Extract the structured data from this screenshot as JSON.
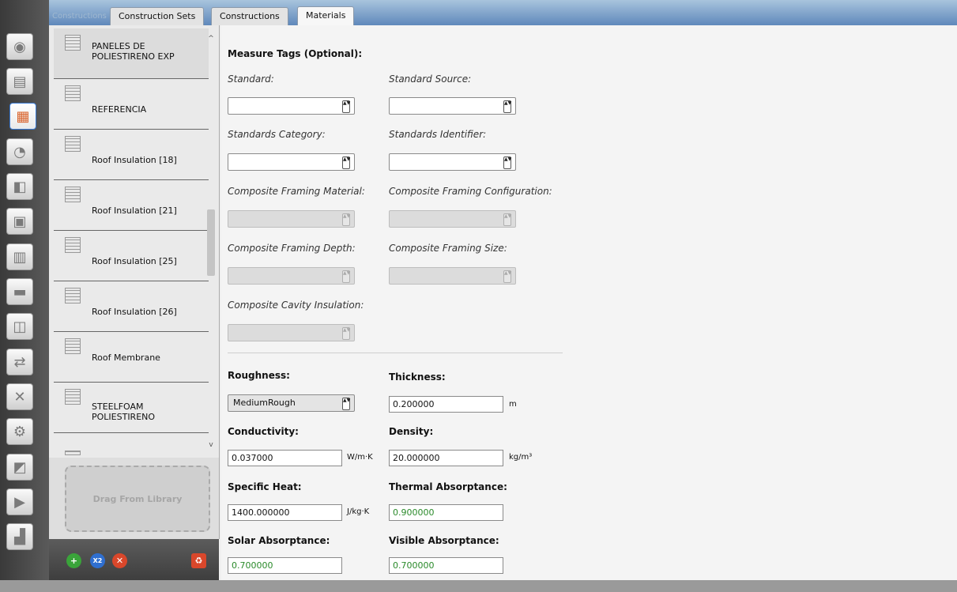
{
  "tabs": {
    "faded_label": "Constructions",
    "construction_sets": "Construction Sets",
    "constructions": "Constructions",
    "materials": "Materials"
  },
  "toolbar_icons": [
    "site-icon",
    "schedules-icon",
    "constructions-icon",
    "loads-icon",
    "space-types-icon",
    "geometry-icon",
    "facility-icon",
    "spaces-icon",
    "thermal-zones-icon",
    "hvac-icon",
    "output-variables-icon",
    "simulation-settings-icon",
    "scripts-icon",
    "run-icon",
    "results-icon"
  ],
  "materials_list": {
    "items": [
      {
        "label": "PANELES DE\nPOLIESTIRENO EXP",
        "selected": true
      },
      {
        "label": "REFERENCIA"
      },
      {
        "label": "Roof Insulation [18]"
      },
      {
        "label": "Roof Insulation [21]"
      },
      {
        "label": "Roof Insulation [25]"
      },
      {
        "label": "Roof Insulation [26]"
      },
      {
        "label": "Roof Membrane"
      },
      {
        "label": "STEELFOAM\nPOLIESTIRENO"
      }
    ]
  },
  "drop_zone": {
    "label": "Drag From Library"
  },
  "bottom_buttons": {
    "add": "+",
    "copy": "X2",
    "remove": "✕",
    "purge": "♻"
  },
  "measure_tags": {
    "heading": "Measure Tags (Optional):",
    "standard": {
      "label": "Standard:",
      "value": ""
    },
    "standard_source": {
      "label": "Standard Source:",
      "value": ""
    },
    "standards_category": {
      "label": "Standards Category:",
      "value": ""
    },
    "standards_identifier": {
      "label": "Standards Identifier:",
      "value": ""
    },
    "composite_framing_material": {
      "label": "Composite Framing Material:",
      "value": ""
    },
    "composite_framing_configuration": {
      "label": "Composite Framing Configuration:",
      "value": ""
    },
    "composite_framing_depth": {
      "label": "Composite Framing Depth:",
      "value": ""
    },
    "composite_framing_size": {
      "label": "Composite Framing Size:",
      "value": ""
    },
    "composite_cavity_insulation": {
      "label": "Composite Cavity Insulation:",
      "value": ""
    }
  },
  "properties": {
    "roughness": {
      "label": "Roughness:",
      "value": "MediumRough"
    },
    "thickness": {
      "label": "Thickness:",
      "value": "0.200000",
      "unit": "m"
    },
    "conductivity": {
      "label": "Conductivity:",
      "value": "0.037000",
      "unit": "W/m·K"
    },
    "density": {
      "label": "Density:",
      "value": "20.000000",
      "unit": "kg/m³"
    },
    "specific_heat": {
      "label": "Specific Heat:",
      "value": "1400.000000",
      "unit": "J/kg·K"
    },
    "thermal_absorptance": {
      "label": "Thermal Absorptance:",
      "value": "0.900000"
    },
    "solar_absorptance": {
      "label": "Solar Absorptance:",
      "value": "0.700000"
    },
    "visible_absorptance": {
      "label": "Visible Absorptance:",
      "value": "0.700000"
    }
  },
  "colors": {
    "accent": "#3a7bd5",
    "default_value_text": "#2a8a2a",
    "tab_strip": "#5f88bb"
  }
}
